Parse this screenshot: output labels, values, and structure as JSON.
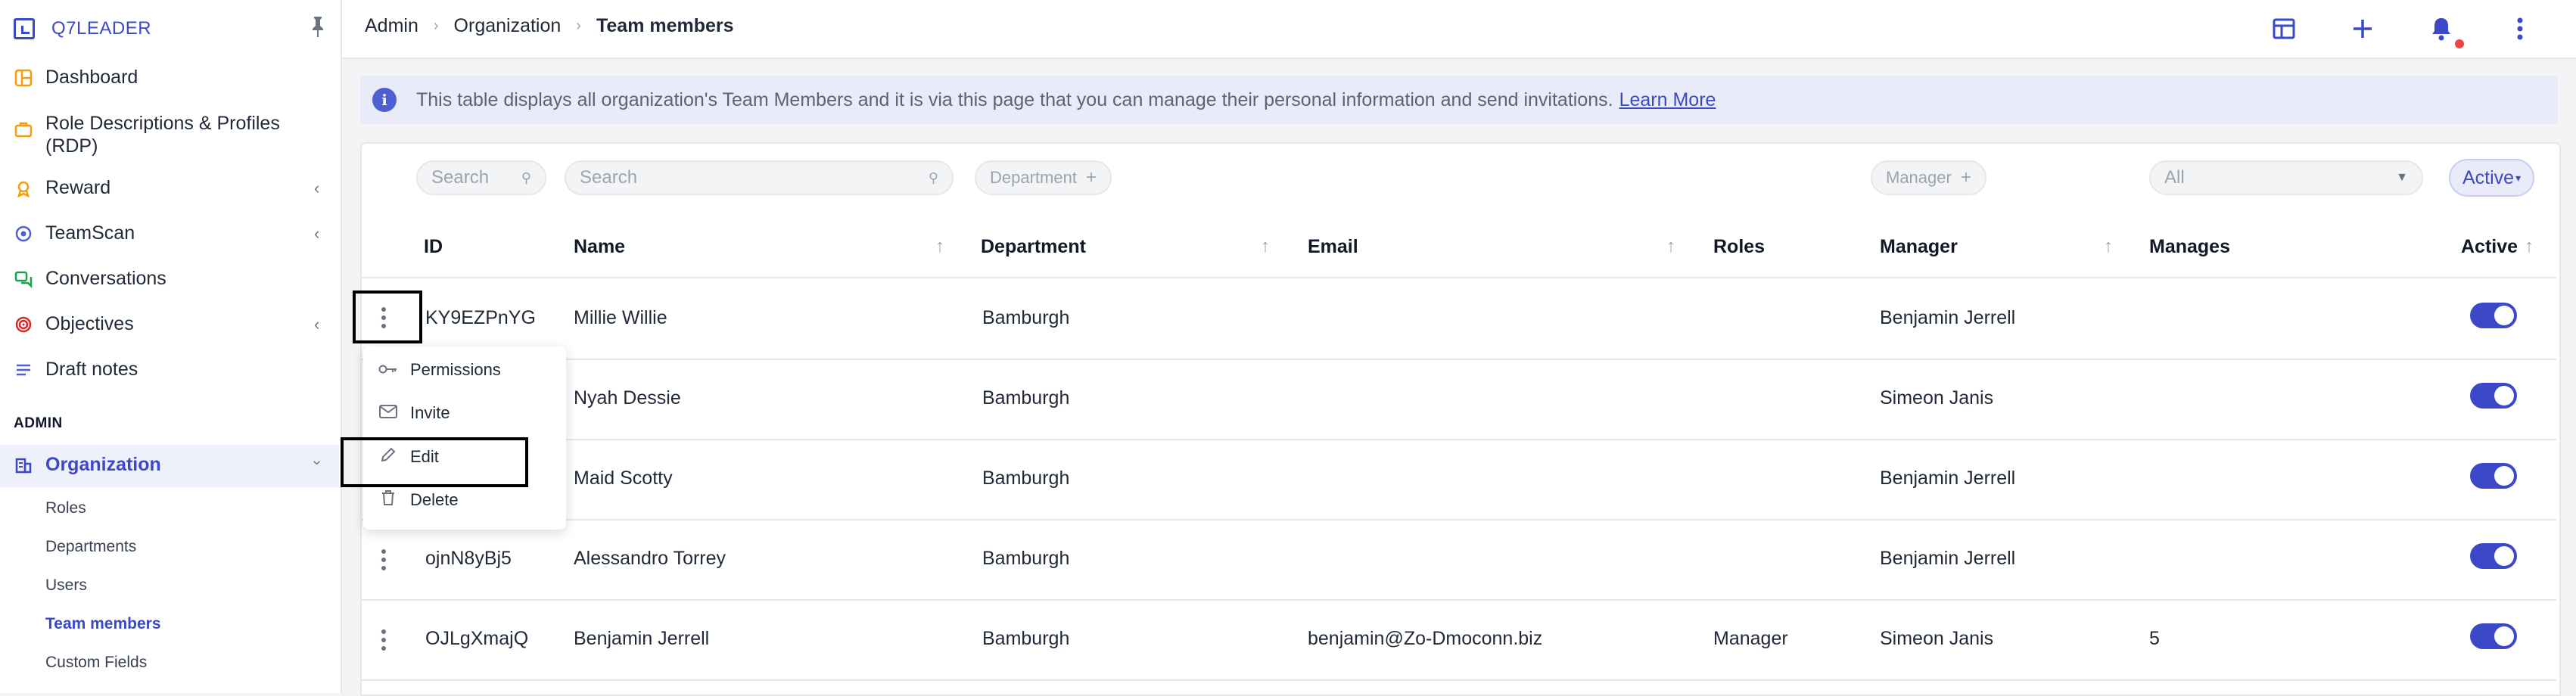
{
  "app": {
    "brand": "Q7LEADER"
  },
  "sidebar": {
    "items": [
      {
        "label": "Dashboard",
        "icon": "dashboard-icon"
      },
      {
        "label": "Role Descriptions & Profiles",
        "label2": "(RDP)",
        "icon": "briefcase-icon"
      },
      {
        "label": "Reward",
        "icon": "reward-icon"
      },
      {
        "label": "TeamScan",
        "icon": "teamscan-icon"
      },
      {
        "label": "Conversations",
        "icon": "chat-icon"
      },
      {
        "label": "Objectives",
        "icon": "target-icon"
      },
      {
        "label": "Draft notes",
        "icon": "notes-icon"
      }
    ],
    "admin_label": "ADMIN",
    "organization": "Organization",
    "sub_items": [
      "Roles",
      "Departments",
      "Users",
      "Team members",
      "Custom Fields"
    ]
  },
  "breadcrumb": {
    "items": [
      "Admin",
      "Organization"
    ],
    "current": "Team members"
  },
  "info": {
    "text": "This table displays all organization's Team Members and it is via this page that you can manage their personal information and send invitations.",
    "link": "Learn More"
  },
  "filters": {
    "id_search_placeholder": "Search",
    "name_search_placeholder": "Search",
    "department": "Department",
    "manager": "Manager",
    "manages_value": "All",
    "active_value": "Active"
  },
  "table": {
    "columns": [
      "ID",
      "Name",
      "Department",
      "Email",
      "Roles",
      "Manager",
      "Manages",
      "Active"
    ],
    "rows": [
      {
        "id": "KY9EZPnYG",
        "name": "Millie Willie",
        "department": "Bamburgh",
        "email": "",
        "roles": "",
        "manager": "Benjamin Jerrell",
        "manages": "",
        "active": true
      },
      {
        "id": "",
        "name": "Nyah Dessie",
        "department": "Bamburgh",
        "email": "",
        "roles": "",
        "manager": "Simeon Janis",
        "manages": "",
        "active": true
      },
      {
        "id": "",
        "name": "Maid Scotty",
        "department": "Bamburgh",
        "email": "",
        "roles": "",
        "manager": "Benjamin Jerrell",
        "manages": "",
        "active": true
      },
      {
        "id": "ojnN8yBj5",
        "name": "Alessandro Torrey",
        "department": "Bamburgh",
        "email": "",
        "roles": "",
        "manager": "Benjamin Jerrell",
        "manages": "",
        "active": true
      },
      {
        "id": "OJLgXmajQ",
        "name": "Benjamin Jerrell",
        "department": "Bamburgh",
        "email": "benjamin@Zo-Dmoconn.biz",
        "roles": "Manager",
        "manager": "Simeon Janis",
        "manages": "5",
        "active": true
      }
    ]
  },
  "row_menu": {
    "items": [
      {
        "label": "Permissions",
        "icon": "key-icon"
      },
      {
        "label": "Invite",
        "icon": "mail-icon"
      },
      {
        "label": "Edit",
        "icon": "pencil-icon"
      },
      {
        "label": "Delete",
        "icon": "trash-icon"
      }
    ]
  },
  "colors": {
    "accent": "#3b49c9",
    "highlight": "#000000"
  }
}
